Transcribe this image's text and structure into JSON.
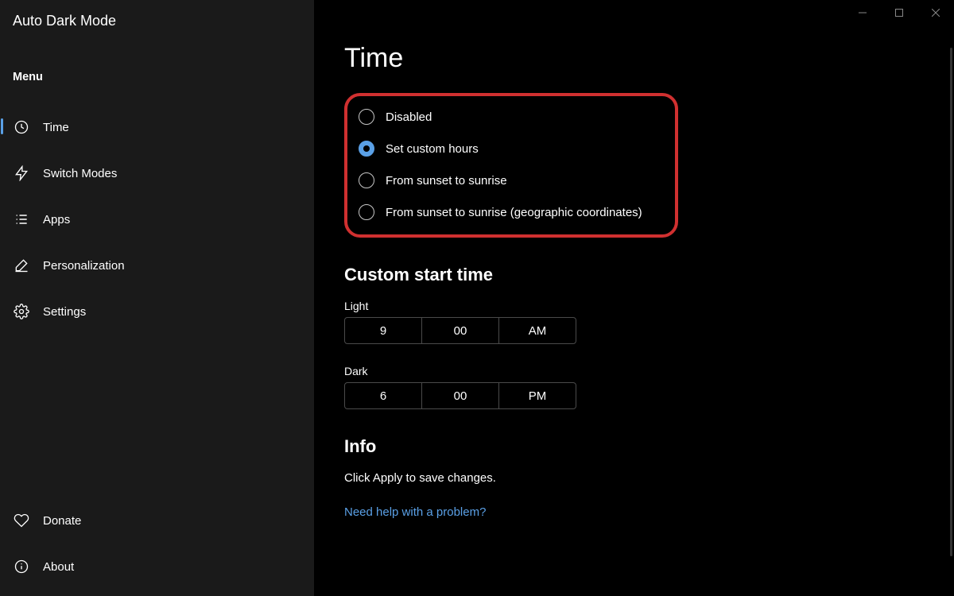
{
  "window": {
    "title": "Auto Dark Mode",
    "controls": {
      "minimize": "minimize-icon",
      "maximize": "maximize-icon",
      "close": "close-icon"
    }
  },
  "sidebar": {
    "menu_label": "Menu",
    "items": [
      {
        "icon": "clock-icon",
        "label": "Time",
        "active": true
      },
      {
        "icon": "lightning-icon",
        "label": "Switch Modes",
        "active": false
      },
      {
        "icon": "list-icon",
        "label": "Apps",
        "active": false
      },
      {
        "icon": "edit-icon",
        "label": "Personalization",
        "active": false
      },
      {
        "icon": "gear-icon",
        "label": "Settings",
        "active": false
      }
    ],
    "bottom_items": [
      {
        "icon": "heart-icon",
        "label": "Donate"
      },
      {
        "icon": "info-icon",
        "label": "About"
      }
    ]
  },
  "main": {
    "title": "Time",
    "mode_options": [
      {
        "label": "Disabled",
        "selected": false
      },
      {
        "label": "Set custom hours",
        "selected": true
      },
      {
        "label": "From sunset to sunrise",
        "selected": false
      },
      {
        "label": "From sunset to sunrise (geographic coordinates)",
        "selected": false
      }
    ],
    "custom_start": {
      "heading": "Custom start time",
      "light_label": "Light",
      "light": {
        "hour": "9",
        "minute": "00",
        "ampm": "AM"
      },
      "dark_label": "Dark",
      "dark": {
        "hour": "6",
        "minute": "00",
        "ampm": "PM"
      }
    },
    "info": {
      "heading": "Info",
      "text": "Click Apply to save changes.",
      "help_link": "Need help with a problem?"
    }
  }
}
